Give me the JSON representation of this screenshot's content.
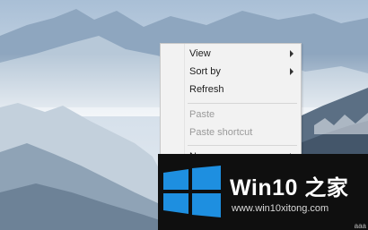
{
  "context_menu": {
    "items": [
      {
        "label": "View",
        "has_submenu": true,
        "enabled": true
      },
      {
        "label": "Sort by",
        "has_submenu": true,
        "enabled": true
      },
      {
        "label": "Refresh",
        "has_submenu": false,
        "enabled": true
      },
      {
        "label": "Paste",
        "has_submenu": false,
        "enabled": false
      },
      {
        "label": "Paste shortcut",
        "has_submenu": false,
        "enabled": false
      },
      {
        "label": "New",
        "has_submenu": true,
        "enabled": true
      }
    ]
  },
  "banner": {
    "brand_name": "Win10",
    "brand_suffix": "之家",
    "url": "www.win10xitong.com",
    "logo_icon": "windows-logo-icon",
    "colors": {
      "background": "#0f0f0f",
      "logo": "#1e8fe0",
      "text": "#ffffff"
    }
  },
  "watermark": {
    "text": "aaa"
  },
  "colors": {
    "sky": "#c7d6e6",
    "mountains": "#5d7187",
    "menu_bg": "#f2f2f2"
  }
}
